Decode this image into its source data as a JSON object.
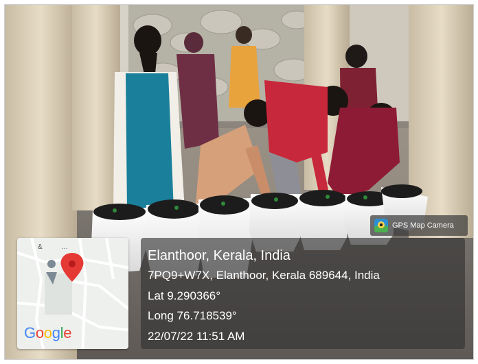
{
  "photo": {
    "description_icon": "photo-scene"
  },
  "map": {
    "logo_text": [
      "G",
      "o",
      "o",
      "g",
      "l",
      "e"
    ],
    "pin_color": "#E53935",
    "marker_icon": "location-pin-icon",
    "person_icon": "map-person-icon"
  },
  "badge": {
    "label": "GPS Map Camera",
    "icon": "gps-map-camera-icon"
  },
  "location": {
    "place": "Elanthoor, Kerala, India",
    "address": "7PQ9+W7X, Elanthoor, Kerala 689644, India",
    "lat": "Lat 9.290366°",
    "long": "Long 76.718539°",
    "datetime": "22/07/22 11:51 AM"
  },
  "colors": {
    "overlay": "#303030",
    "text": "#ffffff"
  }
}
